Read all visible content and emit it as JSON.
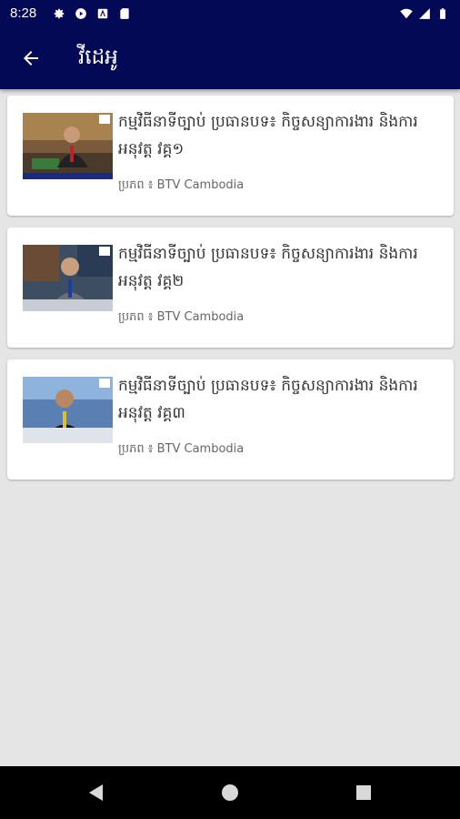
{
  "status_bar": {
    "time": "8:28",
    "left_icons": [
      "settings-icon",
      "play-store-icon",
      "app-icon",
      "sd-card-icon"
    ],
    "right_icons": [
      "wifi-icon",
      "signal-icon",
      "battery-icon"
    ]
  },
  "app_bar": {
    "back_icon": "arrow-left-icon",
    "title": "វីដេអូ",
    "background_color": "#030955"
  },
  "videos": [
    {
      "title": "កម្មវិធីនាទីច្បាប់ ប្រធានបទ៖ កិច្ចសន្យាការងារ និងការអនុវត្ត វគ្គ១",
      "source": "ប្រភព ៖ BTV Cambodia"
    },
    {
      "title": "កម្មវិធីនាទីច្បាប់ ប្រធានបទ៖ កិច្ចសន្យាការងារ និងការអនុវត្ត វគ្គ២",
      "source": "ប្រភព ៖ BTV Cambodia"
    },
    {
      "title": "កម្មវិធីនាទីច្បាប់ ប្រធានបទ៖ កិច្ចសន្យាការងារ និងការអនុវត្ត វគ្គ៣",
      "source": "ប្រភព ៖ BTV Cambodia"
    }
  ],
  "nav_bar": {
    "buttons": [
      "back-triangle-icon",
      "home-circle-icon",
      "recents-square-icon"
    ]
  }
}
